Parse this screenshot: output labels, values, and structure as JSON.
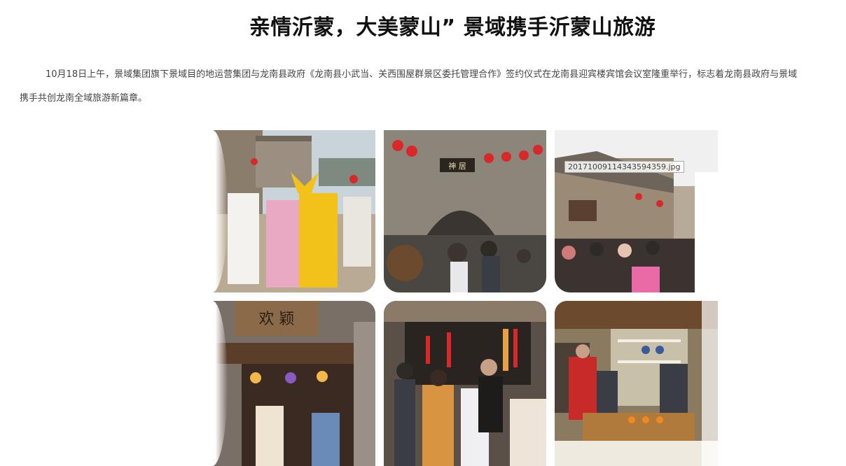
{
  "article": {
    "title": "亲情沂蒙，大美蒙山” 景域携手沂蒙山旅游",
    "paragraph_line1": "10月18日上午，景域集团旗下景域目的地运营集团与龙南县政府《龙南县小武当、关西围屋群景区委托管理合作》签约仪式在龙南县迎宾楼宾馆会议室隆重举行，标志着龙南县政府与景域",
    "paragraph_line2": "携手共创龙南全域旅游新篇章。"
  },
  "gallery": {
    "image3_filename_tooltip": "20171009114343594359.jpg",
    "image4_sign_text": "欢 颖",
    "image2_sign_text": "神 居"
  },
  "colors": {
    "accent_red": "#d8282a",
    "stone_gray": "#8c857a",
    "wood_brown": "#6b4a2e",
    "imperial_yellow": "#f2c21b"
  }
}
